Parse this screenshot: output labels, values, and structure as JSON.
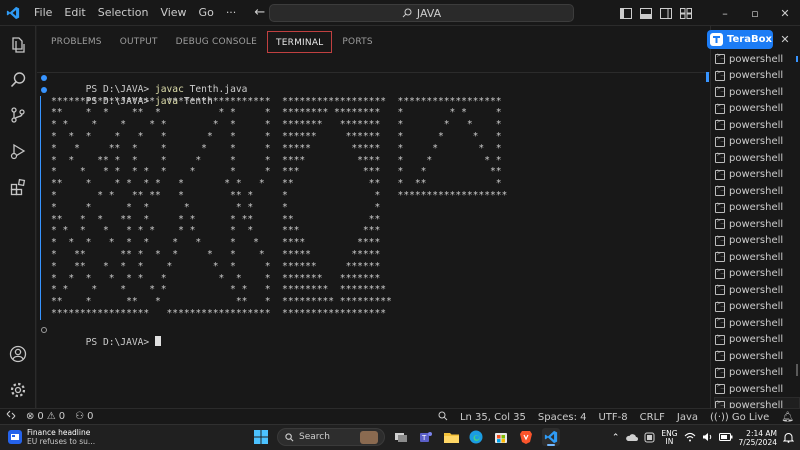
{
  "titlebar": {
    "menu": [
      "File",
      "Edit",
      "Selection",
      "View",
      "Go",
      "···"
    ],
    "back": "←",
    "forward": "→",
    "search_text": "JAVA",
    "minimize": "–",
    "restore": "▫",
    "close": "✕"
  },
  "panel": {
    "tabs": [
      "PROBLEMS",
      "OUTPUT",
      "DEBUG CONSOLE",
      "TERMINAL",
      "PORTS"
    ],
    "active_tab": "TERMINAL"
  },
  "terminal": {
    "prompt": "PS D:\\JAVA> ",
    "commands": [
      {
        "cmd": "javac",
        "arg": " Tenth.java"
      },
      {
        "cmd": "java",
        "arg": " Tenth"
      }
    ],
    "output": [
      "******************  ******************  ******************  ******************",
      "**    *  *    **  *          * *     *  ******** ********   *        * *     *",
      "* *    *    *    * *        *  *     *  *******   *******   *       *   *    *",
      "*  *  *    *   *   *       *   *     *  ******     ******   *      *     *   *",
      "*   *     **  *    *      *    *     *  *****       *****   *     *       *  *",
      "*  *    ** *  *    *     *     *     *  ****         ****   *    *         * *",
      "*    *   * *  * *  *    *      *     *  ***           ***   *   *           **",
      "**    *    * *  * *   *       * *   *   **             **   *  **            *",
      "*       * *   ** **   *        ** *     *               *   *******************",
      "*     *      *  *      *        * *     *               *",
      "**   *  *   **  *     * *      * **     **             **",
      "* *  *   *   * * *    * *      *  *     ***           ***",
      "*  *  *   *  *  *    *   *     *   *    ****         ****",
      "*   **      ** *  *  *     *   *    *   *****       *****",
      "*   **   *  *  *    *       *  *     *  ******     ******",
      "*  *  *   *  * *   *         *  *    *  *******   *******",
      "* *    *    *    * *           * *   *  ********  ********",
      "**    *      **   *             **   *  ********* *********",
      "*****************   ******************  ******************"
    ],
    "final_prompt": "PS D:\\JAVA> "
  },
  "terminal_list": {
    "extension": "TeraBox",
    "items": [
      "powershell",
      "powershell",
      "powershell",
      "powershell",
      "powershell",
      "powershell",
      "powershell",
      "powershell",
      "powershell",
      "powershell",
      "powershell",
      "powershell",
      "powershell",
      "powershell",
      "powershell",
      "powershell",
      "powershell",
      "powershell",
      "powershell",
      "powershell",
      "powershell",
      "powershell"
    ]
  },
  "statusbar": {
    "errors": "0",
    "warnings": "0",
    "ports": "0",
    "position": "Ln 35, Col 35",
    "spaces": "Spaces: 4",
    "encoding": "UTF-8",
    "eol": "CRLF",
    "language": "Java",
    "golive": "Go Live"
  },
  "taskbar": {
    "news_title": "Finance headline",
    "news_sub": "EU refuses to su...",
    "search": "Search",
    "lang_top": "ENG",
    "lang_bottom": "IN",
    "time": "2:14 AM",
    "date": "7/25/2024"
  },
  "colors": {
    "accent": "#3794ff",
    "terabox": "#1c7cf5",
    "command": "#dcdcaa"
  }
}
